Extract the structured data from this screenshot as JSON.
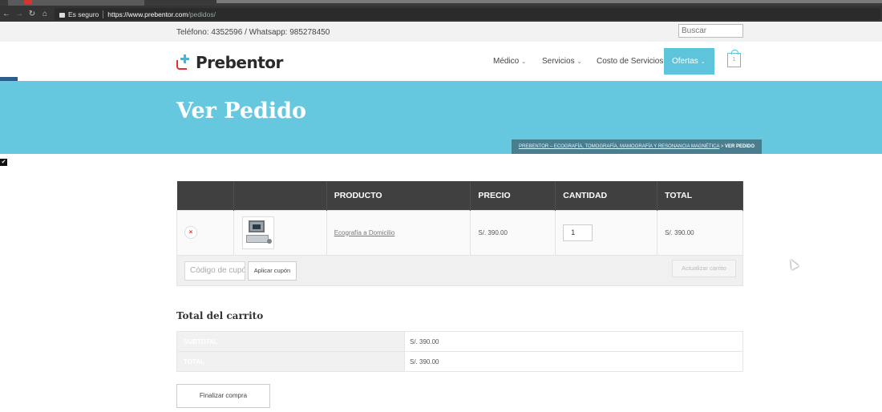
{
  "browser": {
    "secure_label": "Es seguro",
    "url_host": "https://www.prebentor.com",
    "url_path": "/pedidos/"
  },
  "topbar": {
    "phone": "Teléfono: 4352596 / Whatsapp: 985278450",
    "search_placeholder": "Buscar"
  },
  "header": {
    "logo_text": "Prebentor",
    "menu": [
      {
        "label": "Médico",
        "chevron": true
      },
      {
        "label": "Servicios",
        "chevron": true
      },
      {
        "label": "Costo de Servicios",
        "chevron": false
      },
      {
        "label": "Ofertas",
        "chevron": true
      }
    ],
    "chevron_glyph": "⌄",
    "cart_count": "1",
    "active_color": "#5ec4dc"
  },
  "banner": {
    "title": "Ver Pedido",
    "breadcrumb_link": "PREBENTOR – ECOGRAFÍA, TOMOGRAFÍA, MAMOGRAFÍA Y RESONANCIA MAGNÉTICA",
    "breadcrumb_sep": " > ",
    "breadcrumb_current": "VER PEDIDO",
    "color": "#66c8df"
  },
  "cart": {
    "headers": [
      "",
      "",
      "PRODUCTO",
      "PRECIO",
      "CANTIDAD",
      "TOTAL"
    ],
    "items": [
      {
        "remove": "×",
        "product": "Ecografía a Domicilio",
        "price": "S/. 390.00",
        "quantity": "1",
        "total": "S/. 390.00"
      }
    ],
    "coupon_placeholder": "Código de cupón",
    "apply_coupon": "Aplicar cupón",
    "update_cart": "Actualizar carrito"
  },
  "totals": {
    "title": "Total del carrito",
    "rows": [
      {
        "label": "SUBTOTAL",
        "value": "S/. 390.00"
      },
      {
        "label": "TOTAL",
        "value": "S/. 390.00"
      }
    ],
    "checkout": "Finalizar compra"
  }
}
